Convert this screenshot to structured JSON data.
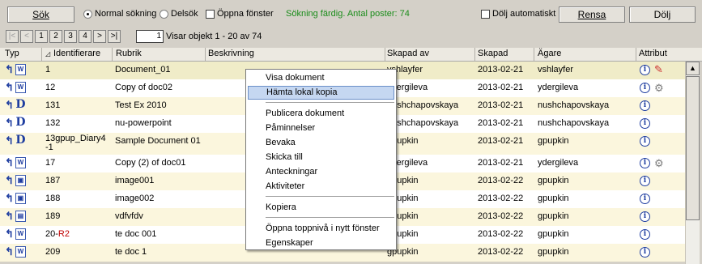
{
  "toolbar": {
    "search_label": "Sök",
    "normal_search_label": "Normal sökning",
    "partial_search_label": "Delsök",
    "open_window_label": "Öppna fönster",
    "status_text": "Sökning färdig. Antal poster: 74",
    "auto_hide_label": "Dölj automatiskt",
    "clear_label": "Rensa",
    "hide_label": "Dölj"
  },
  "pager": {
    "first": "|<",
    "prev": "<",
    "pages": [
      "1",
      "2",
      "3",
      "4"
    ],
    "next": ">",
    "last": ">|",
    "page_value": "1",
    "info": "Visar objekt 1 - 20 av 74"
  },
  "columns": {
    "typ": "Typ",
    "identifierare": "Identifierare",
    "rubrik": "Rubrik",
    "beskrivning": "Beskrivning",
    "skapad_av": "Skapad av",
    "skapad": "Skapad",
    "agare": "Ägare",
    "attribut": "Attribut"
  },
  "rows": [
    {
      "icon": "word-doc-icon",
      "id": "1",
      "id_suffix": "",
      "rubrik": "Document_01",
      "skapad_av": "vshlayfer",
      "skapad": "2013-02-21",
      "agare": "vshlayfer",
      "attr2": "pen-icon"
    },
    {
      "icon": "word-doc-icon",
      "id": "12",
      "id_suffix": "",
      "rubrik": "Copy of doc02",
      "skapad_av": "ydergileva",
      "skapad": "2013-02-21",
      "agare": "ydergileva",
      "attr2": "gear-icon"
    },
    {
      "icon": "d-doc-icon",
      "id": "131",
      "id_suffix": "",
      "rubrik": "Test Ex 2010",
      "skapad_av": "nushchapovskaya",
      "skapad": "2013-02-21",
      "agare": "nushchapovskaya",
      "attr2": ""
    },
    {
      "icon": "d-doc-icon",
      "id": "132",
      "id_suffix": "",
      "rubrik": "nu-powerpoint",
      "skapad_av": "nushchapovskaya",
      "skapad": "2013-02-21",
      "agare": "nushchapovskaya",
      "attr2": ""
    },
    {
      "icon": "d-doc-icon",
      "id": "13gpup_Diary4-1",
      "id_suffix": "",
      "rubrik": "Sample Document 01",
      "skapad_av": "gpupkin",
      "skapad": "2013-02-21",
      "agare": "gpupkin",
      "attr2": ""
    },
    {
      "icon": "word-doc-icon",
      "id": "17",
      "id_suffix": "",
      "rubrik": "Copy (2) of doc01",
      "skapad_av": "ydergileva",
      "skapad": "2013-02-21",
      "agare": "ydergileva",
      "attr2": "gear-icon"
    },
    {
      "icon": "image-doc-icon",
      "id": "187",
      "id_suffix": "",
      "rubrik": "image001",
      "skapad_av": "gpupkin",
      "skapad": "2013-02-22",
      "agare": "gpupkin",
      "attr2": ""
    },
    {
      "icon": "image-doc-icon",
      "id": "188",
      "id_suffix": "",
      "rubrik": "image002",
      "skapad_av": "gpupkin",
      "skapad": "2013-02-22",
      "agare": "gpupkin",
      "attr2": ""
    },
    {
      "icon": "form-doc-icon",
      "id": "189",
      "id_suffix": "",
      "rubrik": "vdfvfdv",
      "skapad_av": "gpupkin",
      "skapad": "2013-02-22",
      "agare": "gpupkin",
      "attr2": ""
    },
    {
      "icon": "word-doc-icon",
      "id": "20-",
      "id_suffix": "R2",
      "rubrik": "te doc 001",
      "skapad_av": "gpupkin",
      "skapad": "2013-02-22",
      "agare": "gpupkin",
      "attr2": ""
    },
    {
      "icon": "word-doc-icon",
      "id": "209",
      "id_suffix": "",
      "rubrik": "te doc 1",
      "skapad_av": "gpupkin",
      "skapad": "2013-02-22",
      "agare": "gpupkin",
      "attr2": ""
    }
  ],
  "context_menu": {
    "items": [
      "Visa dokument",
      "Hämta lokal kopia",
      "Publicera dokument",
      "Påminnelser",
      "Bevaka",
      "Skicka till",
      "Anteckningar",
      "Aktiviteter",
      "Kopiera",
      "Öppna toppnivå i nytt fönster",
      "Egenskaper"
    ],
    "highlighted": "Hämta lokal kopia"
  },
  "icons": {
    "sort": "sort-asc-icon",
    "info": "info-icon",
    "type_arrow": "parent-arrow-icon"
  }
}
